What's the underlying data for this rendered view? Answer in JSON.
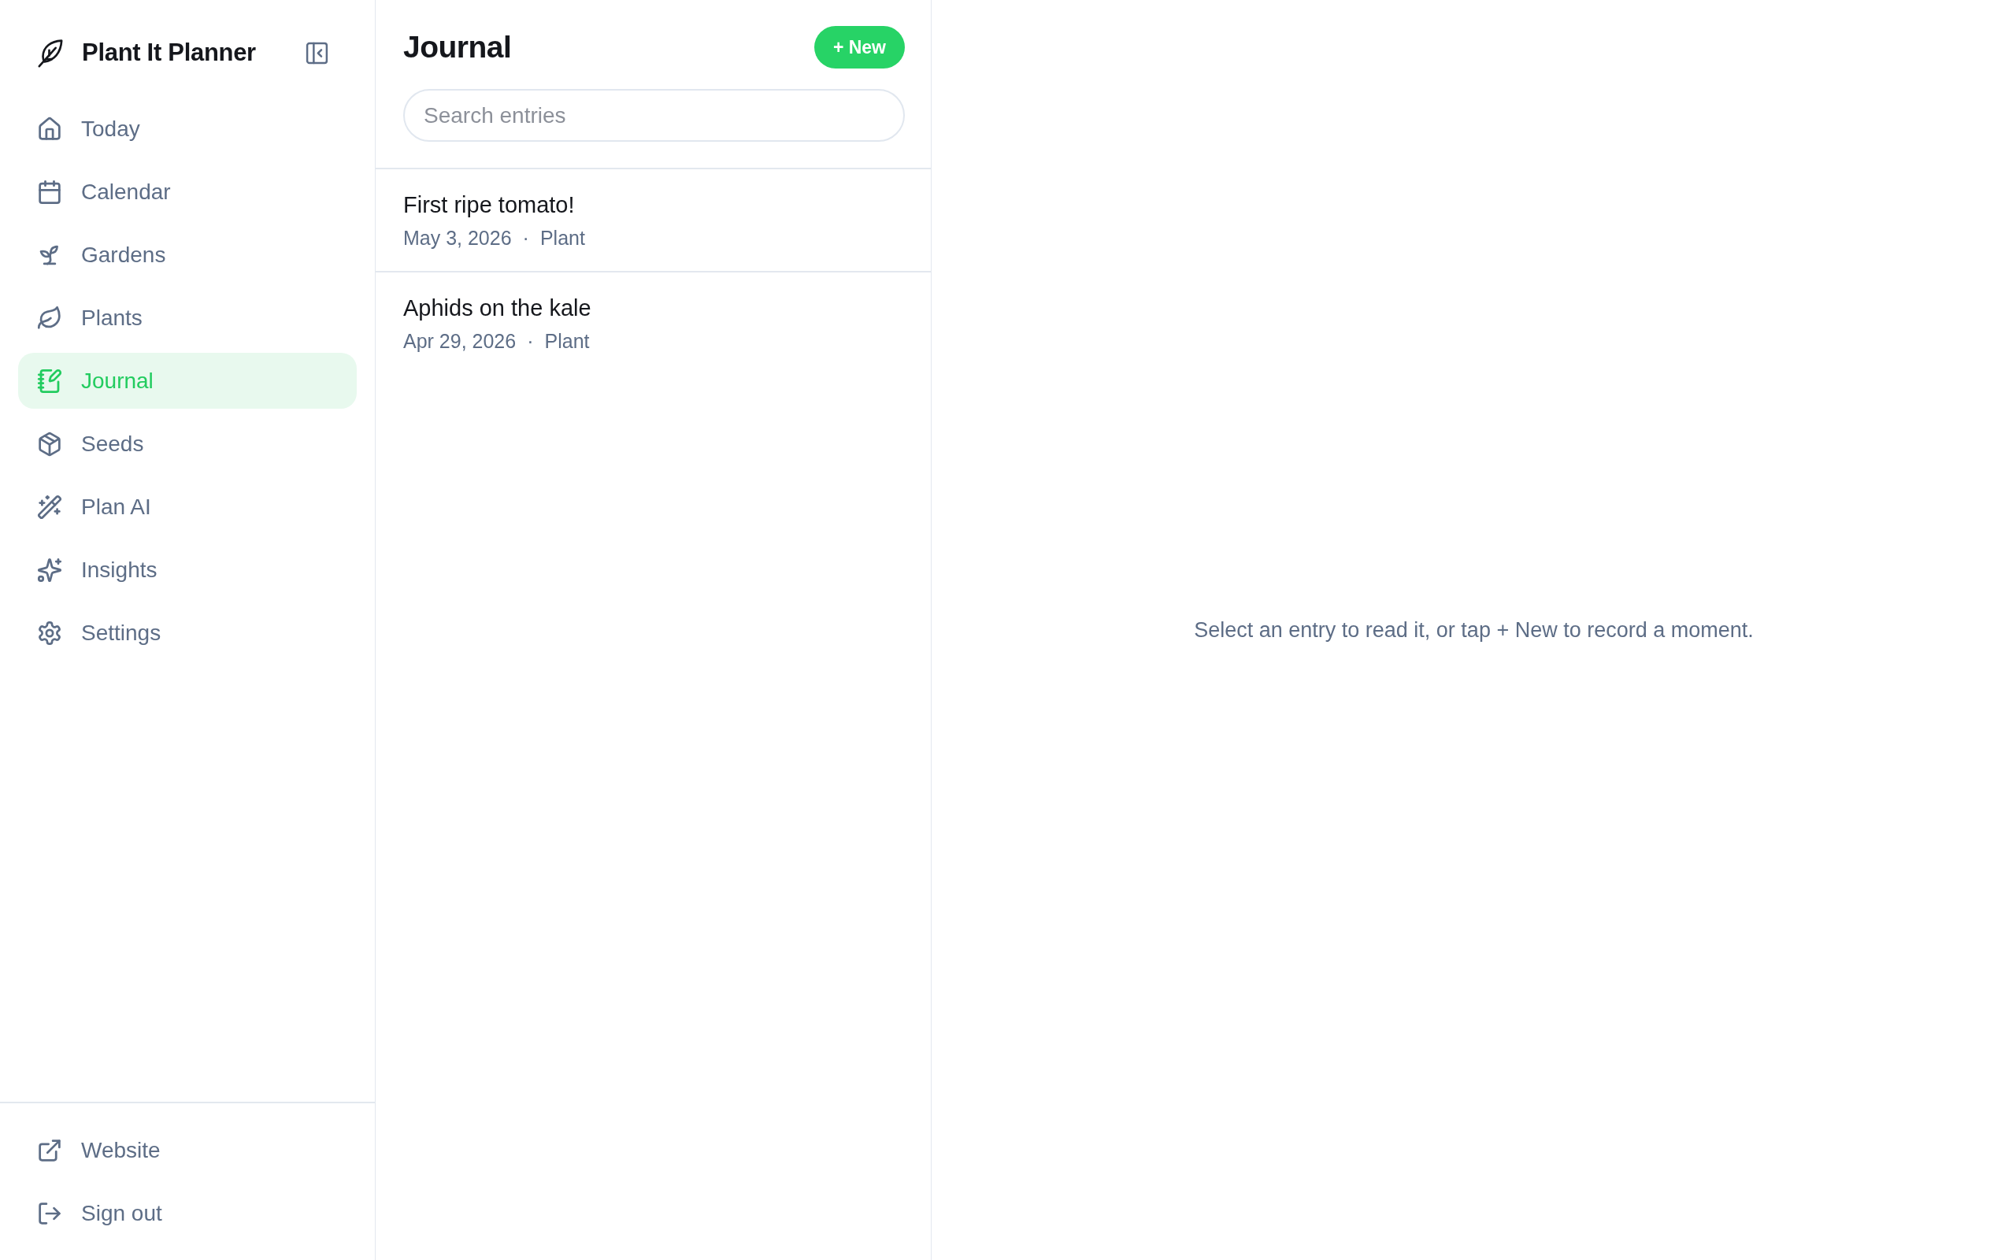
{
  "sidebar": {
    "app_name": "Plant It Planner",
    "nav_items": [
      {
        "label": "Today",
        "selected": false
      },
      {
        "label": "Calendar",
        "selected": false
      },
      {
        "label": "Gardens",
        "selected": false
      },
      {
        "label": "Plants",
        "selected": false
      },
      {
        "label": "Journal",
        "selected": true
      },
      {
        "label": "Seeds",
        "selected": false
      },
      {
        "label": "Plan AI",
        "selected": false
      },
      {
        "label": "Insights",
        "selected": false
      },
      {
        "label": "Settings",
        "selected": false
      }
    ],
    "footer_items": [
      {
        "label": "Website"
      },
      {
        "label": "Sign out"
      }
    ]
  },
  "journal": {
    "title": "Journal",
    "new_button": "+ New",
    "search": {
      "placeholder": "Search entries"
    },
    "entries": [
      {
        "title": "First ripe tomato!",
        "date": "May 3, 2026",
        "separator": "·",
        "category": "Plant",
        "selected": false
      },
      {
        "title": "Aphids on the kale",
        "date": "Apr 29, 2026",
        "separator": "·",
        "category": "Plant",
        "selected": false
      }
    ]
  },
  "detail": {
    "empty_message": "Select an entry to read it, or tap + New to record a moment."
  }
}
